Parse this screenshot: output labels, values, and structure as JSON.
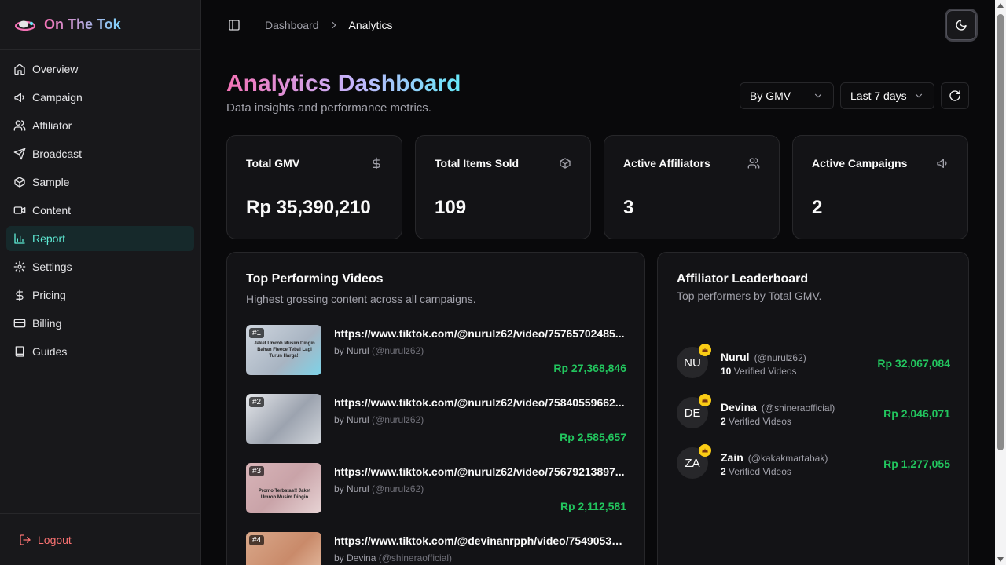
{
  "brand": {
    "name": "On The Tok"
  },
  "sidebar": {
    "items": [
      {
        "label": "Overview",
        "icon": "home-icon"
      },
      {
        "label": "Campaign",
        "icon": "megaphone-icon"
      },
      {
        "label": "Affiliator",
        "icon": "users-icon"
      },
      {
        "label": "Broadcast",
        "icon": "send-icon"
      },
      {
        "label": "Sample",
        "icon": "box-icon"
      },
      {
        "label": "Content",
        "icon": "video-icon"
      },
      {
        "label": "Report",
        "icon": "bar-chart-icon",
        "active": true
      },
      {
        "label": "Settings",
        "icon": "gear-icon"
      },
      {
        "label": "Pricing",
        "icon": "dollar-icon"
      },
      {
        "label": "Billing",
        "icon": "credit-card-icon"
      },
      {
        "label": "Guides",
        "icon": "book-icon"
      }
    ],
    "logout": "Logout"
  },
  "header": {
    "breadcrumb_root": "Dashboard",
    "breadcrumb_current": "Analytics"
  },
  "page": {
    "title": "Analytics Dashboard",
    "subtitle": "Data insights and performance metrics.",
    "metric_select": "By GMV",
    "range_select": "Last 7 days"
  },
  "stats": [
    {
      "label": "Total GMV",
      "value": "Rp 35,390,210",
      "icon": "dollar-icon"
    },
    {
      "label": "Total Items Sold",
      "value": "109",
      "icon": "box-icon"
    },
    {
      "label": "Active Affiliators",
      "value": "3",
      "icon": "users-icon"
    },
    {
      "label": "Active Campaigns",
      "value": "2",
      "icon": "megaphone-icon"
    }
  ],
  "videos": {
    "title": "Top Performing Videos",
    "description": "Highest grossing content across all campaigns.",
    "items": [
      {
        "rank": "#1",
        "url": "https://www.tiktok.com/@nurulz62/video/75765702485...",
        "by": "by Nurul",
        "handle": "(@nurulz62)",
        "gmv": "Rp 27,368,846",
        "thumb_text": "Jaket Umroh Musim Dingin Bahan Fleece Tebal Lagi Turun Harga!!"
      },
      {
        "rank": "#2",
        "url": "https://www.tiktok.com/@nurulz62/video/75840559662...",
        "by": "by Nurul",
        "handle": "(@nurulz62)",
        "gmv": "Rp 2,585,657",
        "thumb_text": ""
      },
      {
        "rank": "#3",
        "url": "https://www.tiktok.com/@nurulz62/video/75679213897...",
        "by": "by Nurul",
        "handle": "(@nurulz62)",
        "gmv": "Rp 2,112,581",
        "thumb_text": "Promo Terbatas!! Jaket Umroh Musim Dingin"
      },
      {
        "rank": "#4",
        "url": "https://www.tiktok.com/@devinanrpph/video/75490530...",
        "by": "by Devina",
        "handle": "(@shineraofficial)",
        "gmv": "",
        "thumb_text": ""
      }
    ]
  },
  "leaderboard": {
    "title": "Affiliator Leaderboard",
    "description": "Top performers by Total GMV.",
    "items": [
      {
        "initials": "NU",
        "name": "Nurul",
        "handle": "(@nurulz62)",
        "count": "10",
        "count_label": "Verified Videos",
        "gmv": "Rp 32,067,084"
      },
      {
        "initials": "DE",
        "name": "Devina",
        "handle": "(@shineraofficial)",
        "count": "2",
        "count_label": "Verified Videos",
        "gmv": "Rp 2,046,071"
      },
      {
        "initials": "ZA",
        "name": "Zain",
        "handle": "(@kakakmartabak)",
        "count": "2",
        "count_label": "Verified Videos",
        "gmv": "Rp 1,277,055"
      }
    ]
  },
  "colors": {
    "accent": "#5eead4",
    "positive": "#22c55e",
    "danger": "#f87171",
    "crown": "#facc15"
  }
}
